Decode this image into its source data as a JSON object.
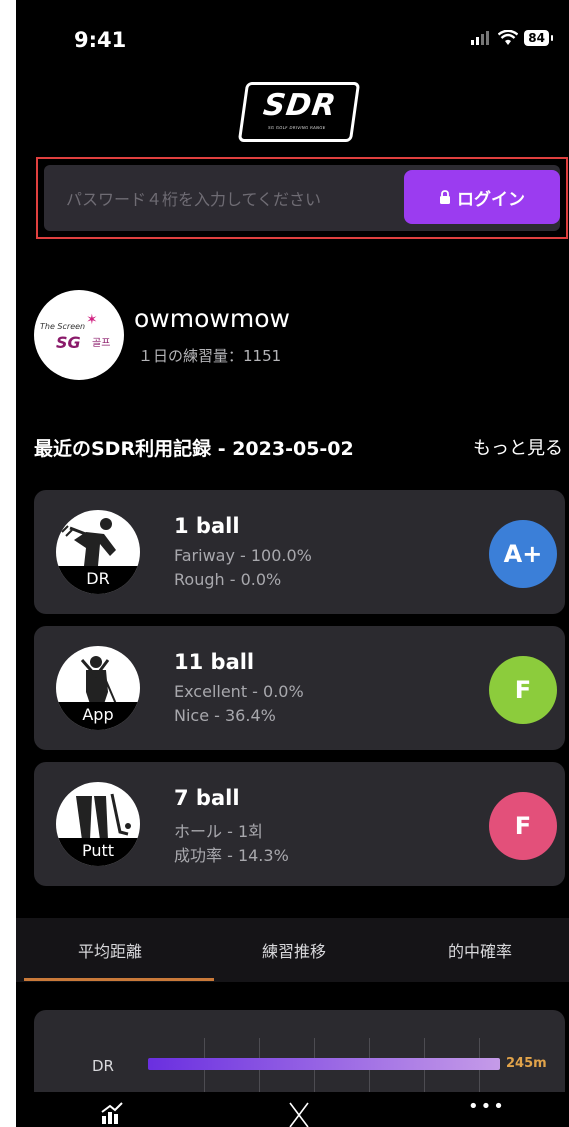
{
  "status_bar": {
    "time": "9:41",
    "battery": "84"
  },
  "logo": {
    "text": "SDR",
    "subtext": "SG GOLF DRIVING RANGE"
  },
  "login": {
    "placeholder": "パスワード４桁を入力してください",
    "button_label": "ログイン"
  },
  "profile": {
    "avatar_text_small": "The Screen",
    "avatar_text_main": "SG",
    "avatar_text_side": "골프",
    "username": "owmowmow",
    "practice_label": "１日の練習量：1151"
  },
  "records": {
    "title": "最近のSDR利用記録 - 2023-05-02",
    "see_more": "もっと見る",
    "cards": [
      {
        "badge": "DR",
        "balls": "1 ball",
        "line1": "Fariway - 100.0%",
        "line2": "Rough - 0.0%",
        "grade": "A+",
        "grade_color": "#3b7fd8",
        "icon": "golfer-swing-icon"
      },
      {
        "badge": "App",
        "balls": "11 ball",
        "line1": "Excellent - 0.0%",
        "line2": "Nice - 36.4%",
        "grade": "F",
        "grade_color": "#8ccc3c",
        "icon": "golfer-approach-icon"
      },
      {
        "badge": "Putt",
        "balls": "7 ball",
        "line1": "ホール - 1회",
        "line2": "成功率 - 14.3%",
        "grade": "F",
        "grade_color": "#e3507a",
        "icon": "golfer-putt-icon"
      }
    ]
  },
  "tabs": [
    {
      "label": "平均距離",
      "active": true
    },
    {
      "label": "練習推移",
      "active": false
    },
    {
      "label": "的中確率",
      "active": false
    }
  ],
  "distance_chart": {
    "row_label": "DR",
    "value_label": "245m",
    "fill_fraction": 0.88
  },
  "bottom_nav": {
    "item1_icon": "chart-up-icon",
    "item2_icon": "golf-clubs-icon",
    "item3_icon": "more-dots-icon",
    "more_label": "•••"
  }
}
